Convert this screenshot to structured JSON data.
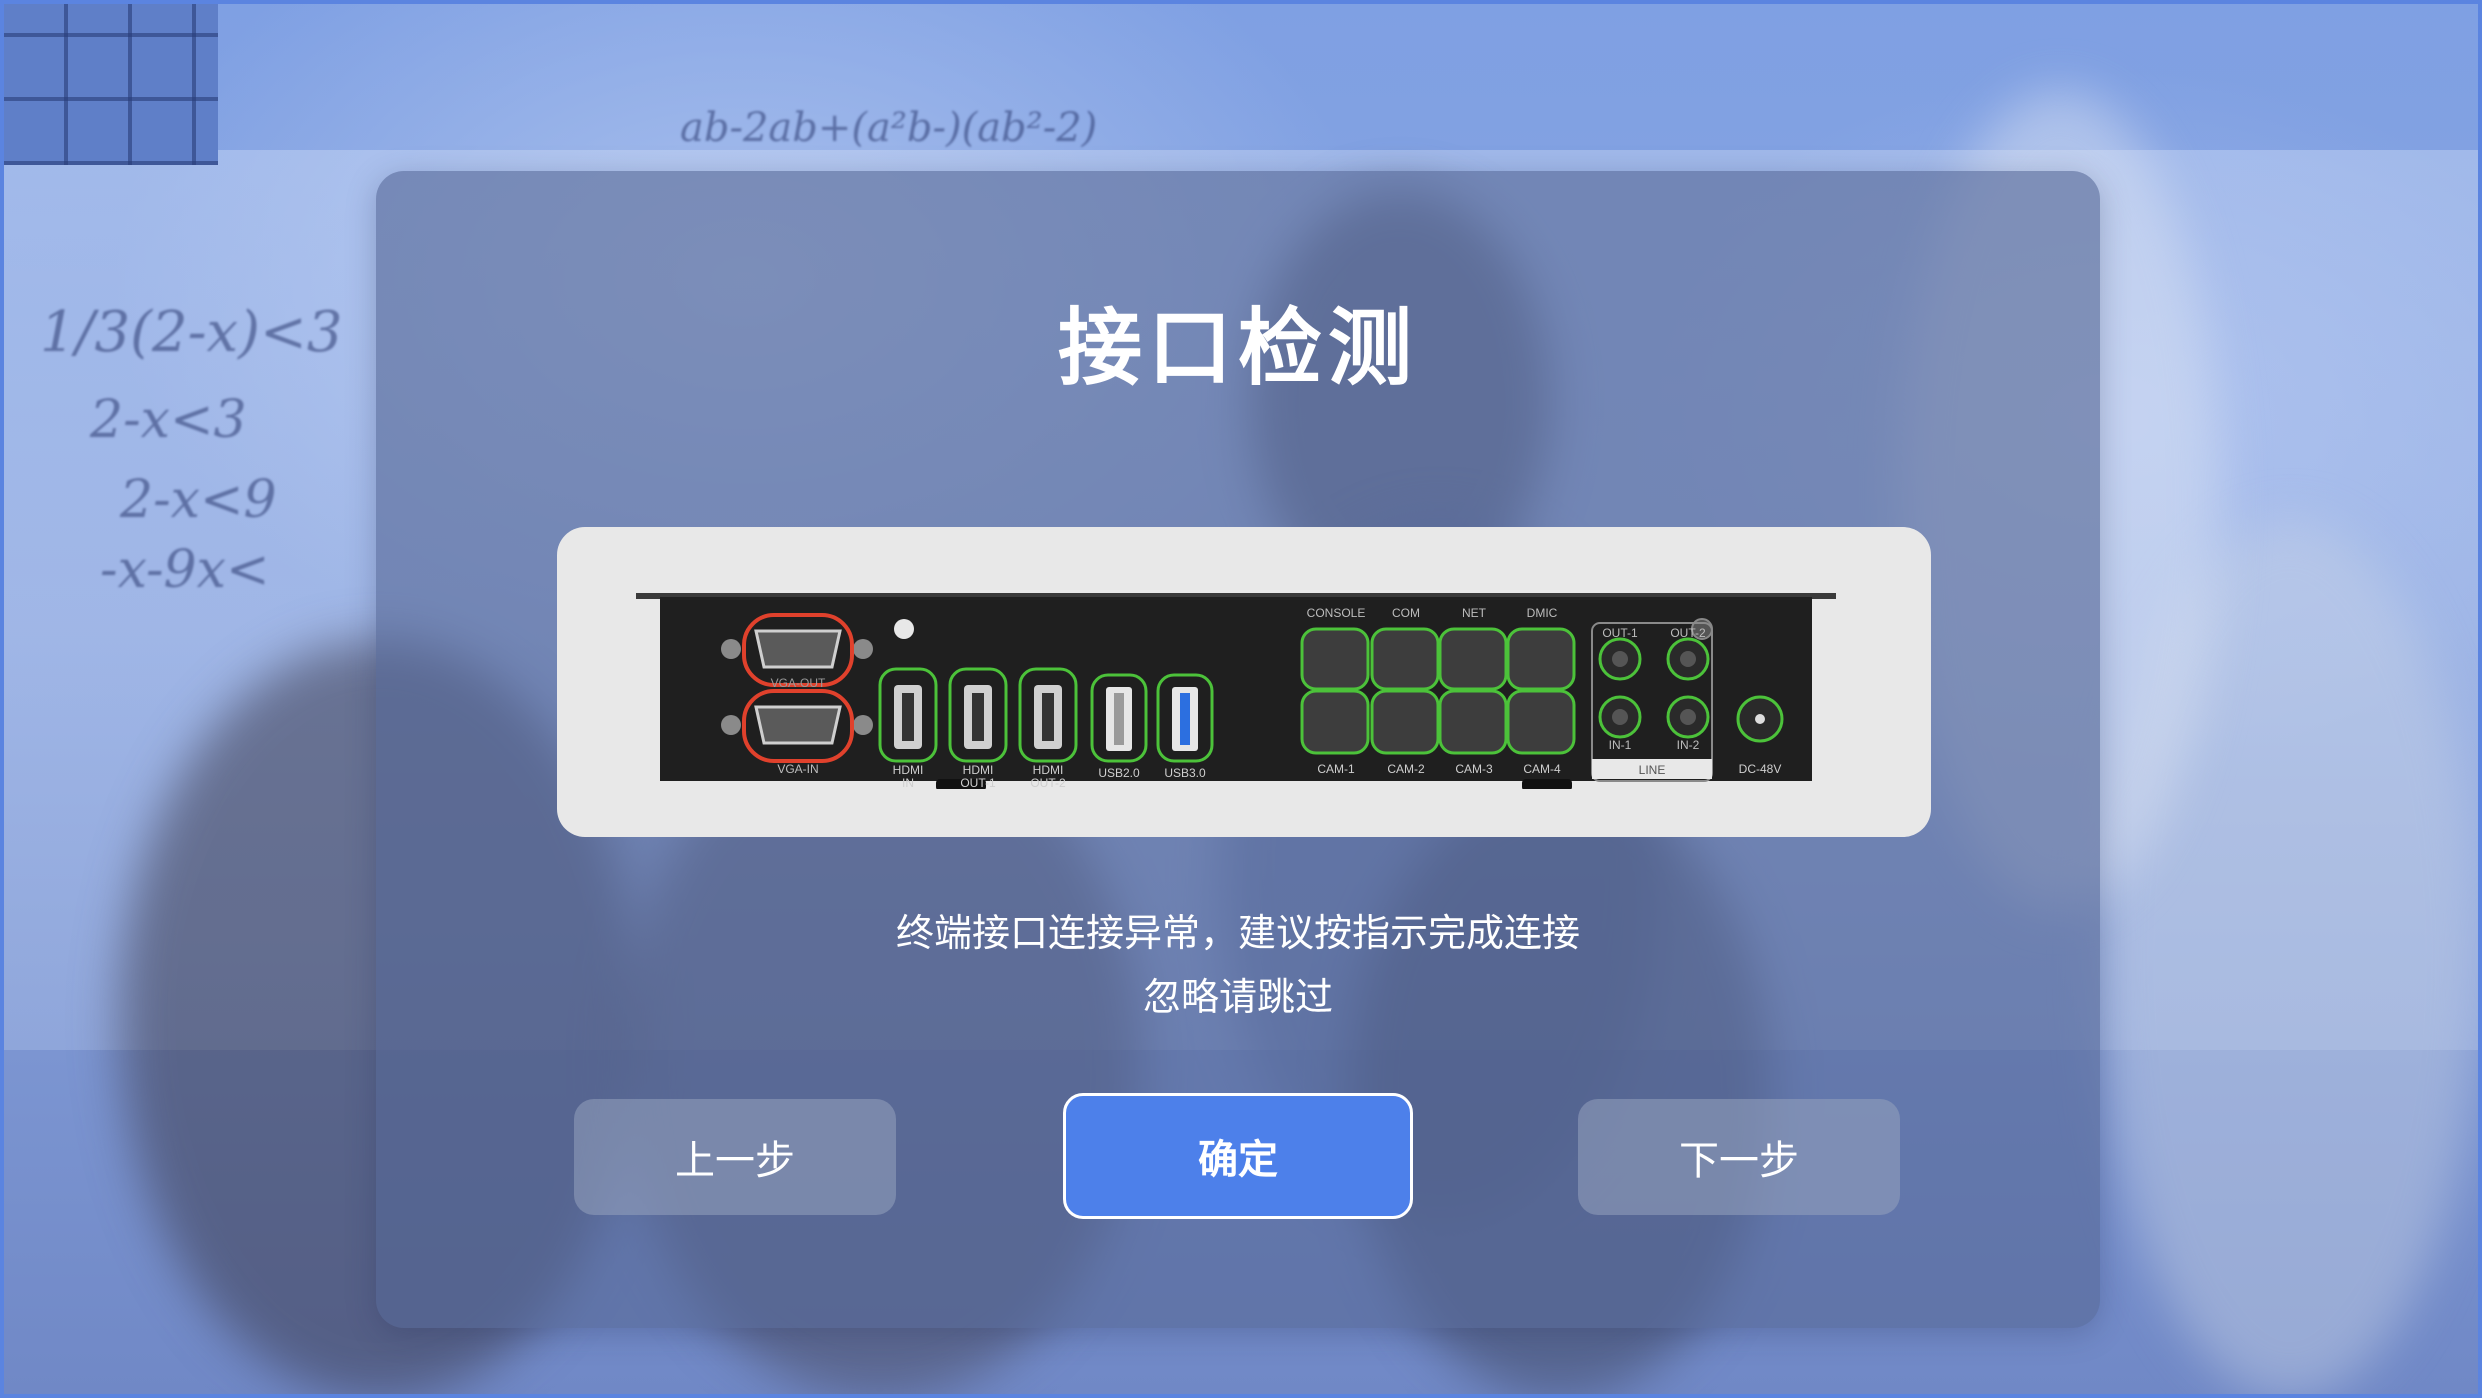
{
  "dialog": {
    "title": "接口检测",
    "message_line1": "终端接口连接异常，建议按指示完成连接",
    "message_line2": "忽略请跳过"
  },
  "buttons": {
    "prev_label": "上一步",
    "confirm_label": "确定",
    "next_label": "下一步"
  },
  "device_panel": {
    "vga_out_label": "VGA-OUT",
    "vga_in_label": "VGA-IN",
    "hdmi_in_label_1": "HDMI",
    "hdmi_in_label_2": "IN",
    "hdmi_out1_label_1": "HDMI",
    "hdmi_out1_label_2": "OUT-1",
    "hdmi_out2_label_1": "HDMI",
    "hdmi_out2_label_2": "OUT-2",
    "usb2_label": "USB2.0",
    "usb3_label": "USB3.0",
    "console_label": "CONSOLE",
    "com_label": "COM",
    "net_label": "NET",
    "dmic_label": "DMIC",
    "cam1_label": "CAM-1",
    "cam2_label": "CAM-2",
    "cam3_label": "CAM-3",
    "cam4_label": "CAM-4",
    "out1_label": "OUT-1",
    "out2_label": "OUT-2",
    "in1_label": "IN-1",
    "in2_label": "IN-2",
    "line_label": "LINE",
    "dc_label": "DC-48V"
  },
  "background_scribbles": [
    "1/3(2-x)<3",
    "2-x<3",
    "2-x<9",
    "-x-9x<",
    "ab-2ab+(a²b-)(ab²-2)"
  ],
  "colors": {
    "ok_port": "#4cc23a",
    "error_port": "#e0412c",
    "accent": "#4d80ea"
  }
}
